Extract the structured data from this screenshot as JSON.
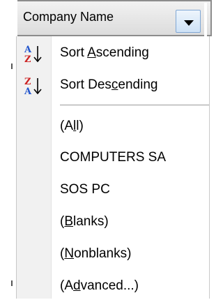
{
  "header": {
    "label": "Company Name",
    "dropdown_icon": "chevron-down-icon"
  },
  "menu": {
    "sort_ascending": {
      "pre": "Sort ",
      "u": "A",
      "post": "scending",
      "icon": "sort-ascending-icon"
    },
    "sort_descending": {
      "pre": "Sort Des",
      "u": "c",
      "post": "ending",
      "icon": "sort-descending-icon"
    },
    "all": {
      "pre": "(A",
      "u": "l",
      "post": "l)"
    },
    "computers_sa": "COMPUTERS SA",
    "sos_pc": "SOS PC",
    "blanks": {
      "pre": "(",
      "u": "B",
      "post": "lanks)"
    },
    "nonblanks": {
      "pre": "(",
      "u": "N",
      "post": "onblanks)"
    },
    "advanced": {
      "pre": "(A",
      "u": "d",
      "post": "vanced...)"
    }
  },
  "colors": {
    "icon_red": "#cc2222",
    "icon_blue": "#2255cc",
    "button_border": "#7fa7d5"
  }
}
